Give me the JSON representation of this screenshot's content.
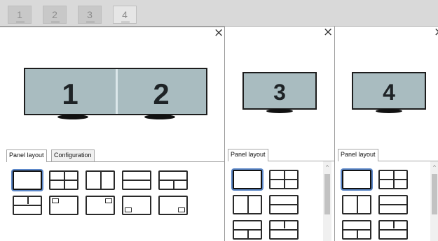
{
  "tabs": [
    {
      "label": "1"
    },
    {
      "label": "2"
    },
    {
      "label": "3"
    },
    {
      "label": "4"
    }
  ],
  "panels": {
    "p12": {
      "close": "×",
      "monitor_labels": [
        "1",
        "2"
      ],
      "tabs": [
        "Panel layout",
        "Configuration"
      ],
      "active_tab": "Panel layout"
    },
    "p3": {
      "close": "×",
      "monitor_label": "3",
      "tabs": [
        "Panel layout"
      ]
    },
    "p4": {
      "close": "×",
      "monitor_label": "4",
      "tabs": [
        "Panel layout"
      ]
    }
  },
  "colors": {
    "screen": "#a9bcc0",
    "selection": "#5b87c9",
    "tabstrip": "#d9d9d9"
  },
  "scroll_arrow": "^"
}
